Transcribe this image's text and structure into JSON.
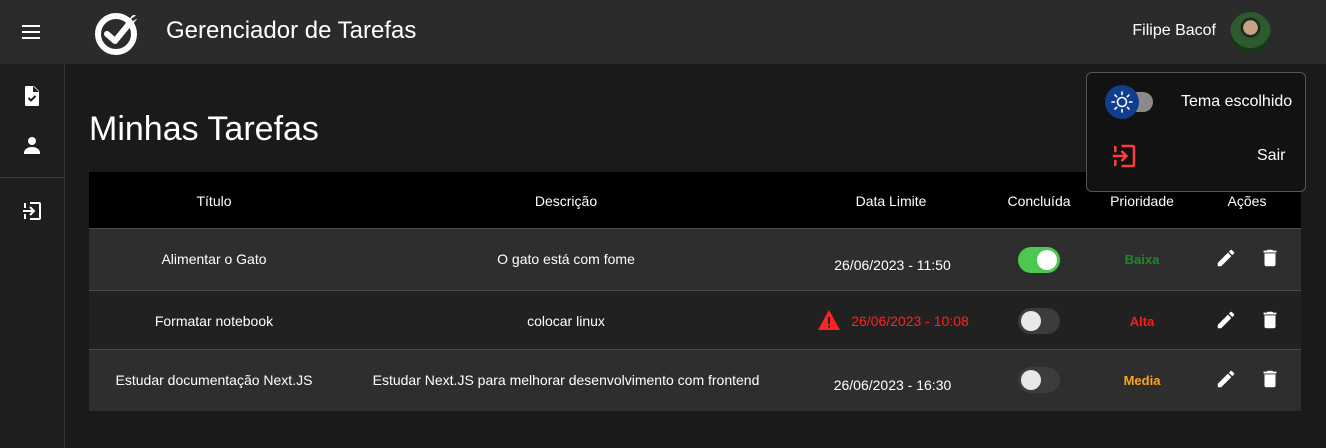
{
  "header": {
    "title": "Gerenciador de Tarefas",
    "user_name": "Filipe Bacof",
    "icons": {
      "menu": "menu-icon",
      "logo": "check-circle-logo",
      "avatar": "user-avatar"
    }
  },
  "sidebar": {
    "items": [
      {
        "name": "tasks",
        "icon": "task-document-icon"
      },
      {
        "name": "profile",
        "icon": "person-icon"
      },
      {
        "name": "logout",
        "icon": "logout-icon"
      }
    ]
  },
  "main": {
    "title": "Minhas Tarefas"
  },
  "table": {
    "headers": [
      "Título",
      "Descrição",
      "Data Limite",
      "Concluída",
      "Prioridade",
      "Ações"
    ],
    "rows": [
      {
        "title": "Alimentar o Gato",
        "description": "O gato está com fome",
        "deadline": "26/06/2023 - 11:50",
        "overdue": false,
        "completed": true,
        "priority": "Baixa",
        "priority_color": "#1a8a2a"
      },
      {
        "title": "Formatar notebook",
        "description": "colocar linux",
        "deadline": "26/06/2023 - 10:08",
        "overdue": true,
        "completed": false,
        "priority": "Alta",
        "priority_color": "#ff1a1a"
      },
      {
        "title": "Estudar documentação Next.JS",
        "description": "Estudar Next.JS para melhorar desenvolvimento com frontend",
        "deadline": "26/06/2023 - 16:30",
        "overdue": false,
        "completed": false,
        "priority": "Media",
        "priority_color": "#ffa31a"
      }
    ],
    "action_icons": [
      "edit-pencil-icon",
      "delete-trash-icon"
    ]
  },
  "popup": {
    "theme_label": "Tema escolhido",
    "logout_label": "Sair",
    "theme_icon": "sun-icon",
    "logout_icon": "logout-icon"
  },
  "colors": {
    "topbar": "#2b2b2b",
    "background": "#1a1a1a",
    "toggle_on": "#4cc751",
    "overdue": "#ff2222",
    "theme_knob": "#103d8e"
  }
}
